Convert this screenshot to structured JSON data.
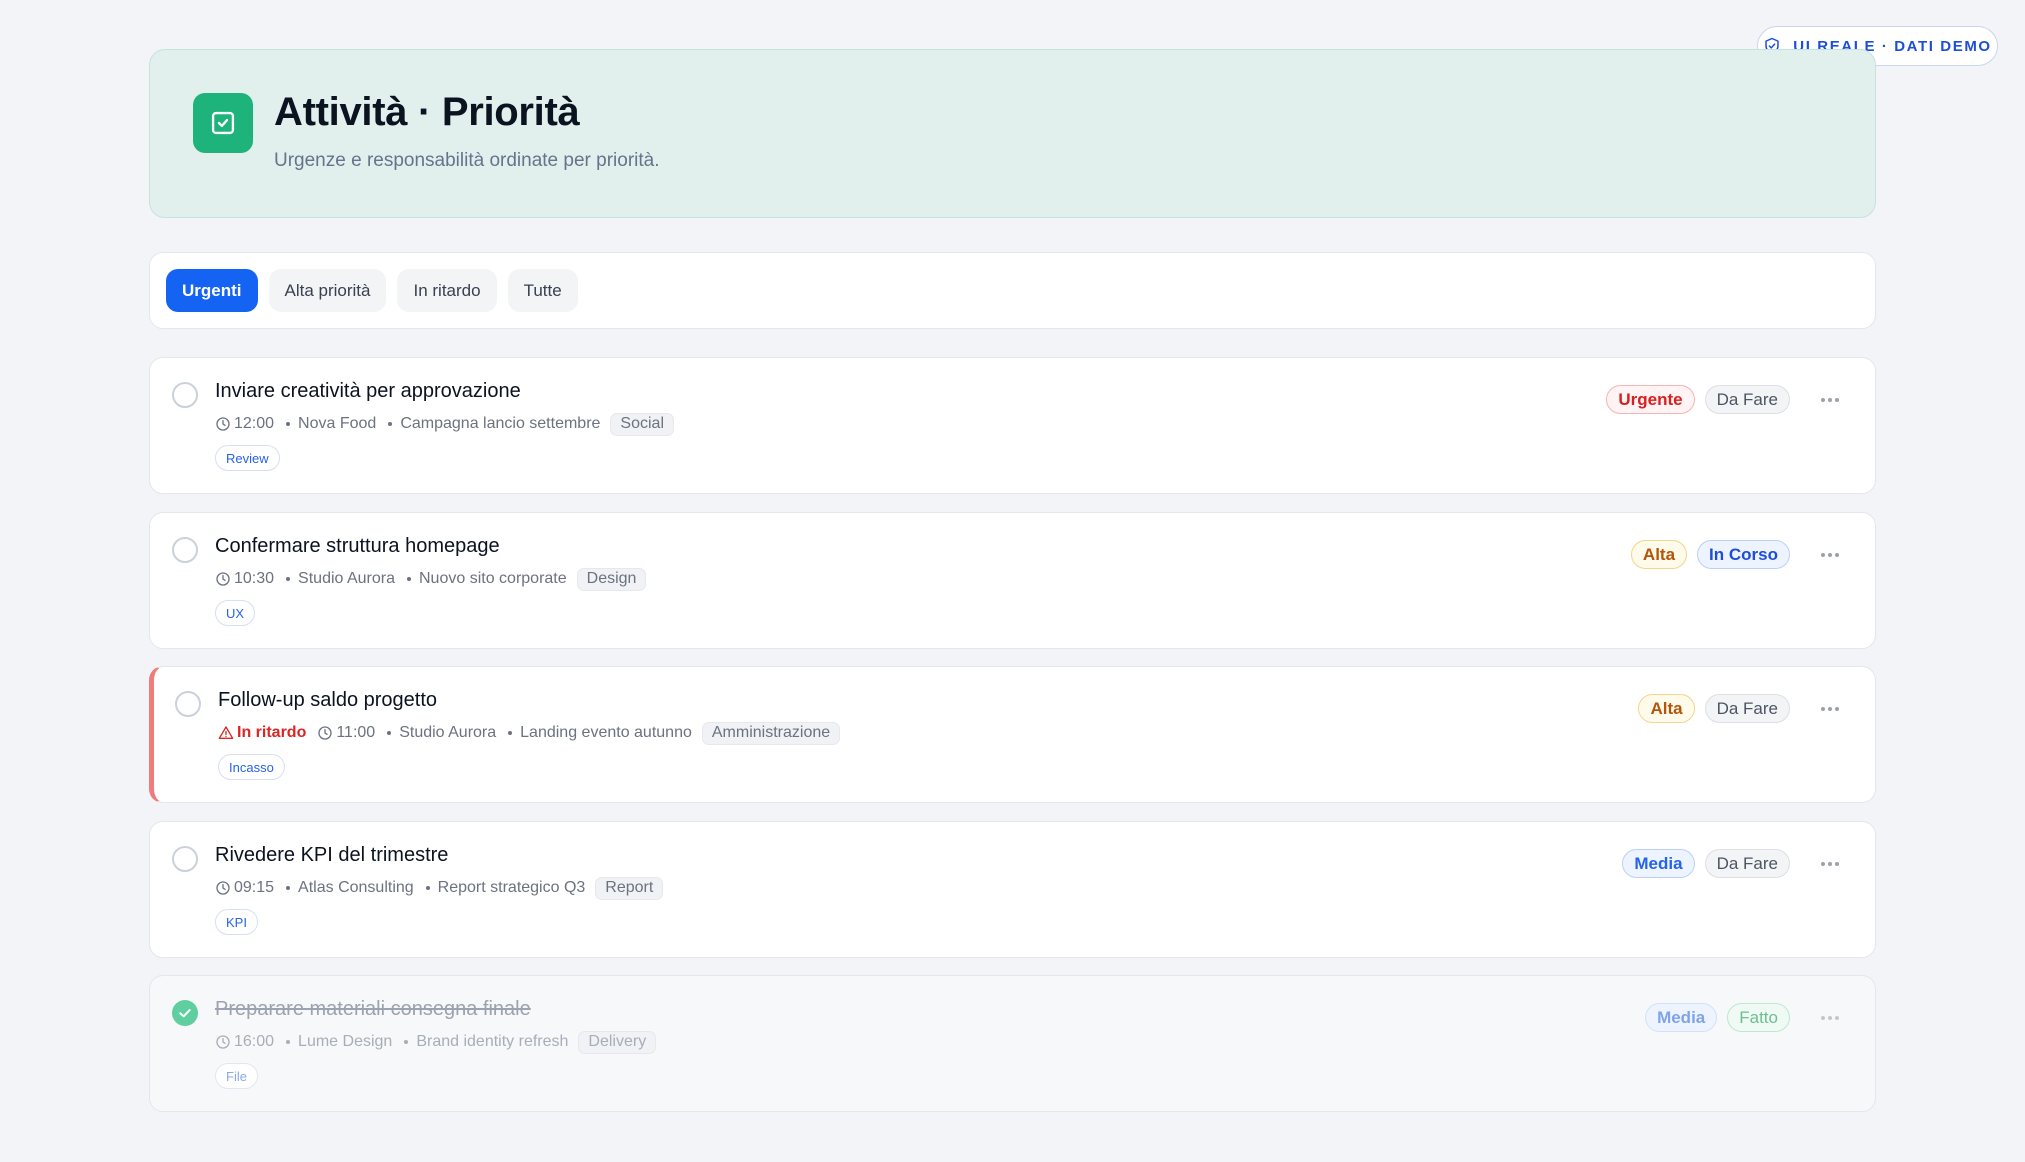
{
  "badge": {
    "label": "UI REALE · DATI DEMO",
    "icon": "shield-check-icon"
  },
  "header": {
    "title": "Attività · Priorità",
    "subtitle": "Urgenze e responsabilità ordinate per priorità.",
    "icon": "checkbox-icon",
    "accent": "#1fb37c"
  },
  "tabs": [
    {
      "label": "Urgenti",
      "active": true
    },
    {
      "label": "Alta priorità",
      "active": false
    },
    {
      "label": "In ritardo",
      "active": false
    },
    {
      "label": "Tutte",
      "active": false
    }
  ],
  "tasks": [
    {
      "title": "Inviare creatività per approvazione",
      "time": "12:00",
      "client": "Nova Food",
      "project": "Campagna lancio settembre",
      "category": "Social",
      "label": "Review",
      "priority": "Urgente",
      "status": "Da Fare",
      "overdue": false,
      "done": false
    },
    {
      "title": "Confermare struttura homepage",
      "time": "10:30",
      "client": "Studio Aurora",
      "project": "Nuovo sito corporate",
      "category": "Design",
      "label": "UX",
      "priority": "Alta",
      "status": "In Corso",
      "overdue": false,
      "done": false
    },
    {
      "title": "Follow-up saldo progetto",
      "overdue_label": "In ritardo",
      "time": "11:00",
      "client": "Studio Aurora",
      "project": "Landing evento autunno",
      "category": "Amministrazione",
      "label": "Incasso",
      "priority": "Alta",
      "status": "Da Fare",
      "overdue": true,
      "done": false
    },
    {
      "title": "Rivedere KPI del trimestre",
      "time": "09:15",
      "client": "Atlas Consulting",
      "project": "Report strategico Q3",
      "category": "Report",
      "label": "KPI",
      "priority": "Media",
      "status": "Da Fare",
      "overdue": false,
      "done": false
    },
    {
      "title": "Preparare materiali consegna finale",
      "time": "16:00",
      "client": "Lume Design",
      "project": "Brand identity refresh",
      "category": "Delivery",
      "label": "File",
      "priority": "Media",
      "status": "Fatto",
      "overdue": false,
      "done": true
    }
  ],
  "colors": {
    "primary": "#1463f3",
    "urgent": "#d91f1f",
    "high": "#b45309",
    "medium": "#2563eb",
    "done": "#5fcf9f",
    "overdue_border": "#f07b7b"
  }
}
